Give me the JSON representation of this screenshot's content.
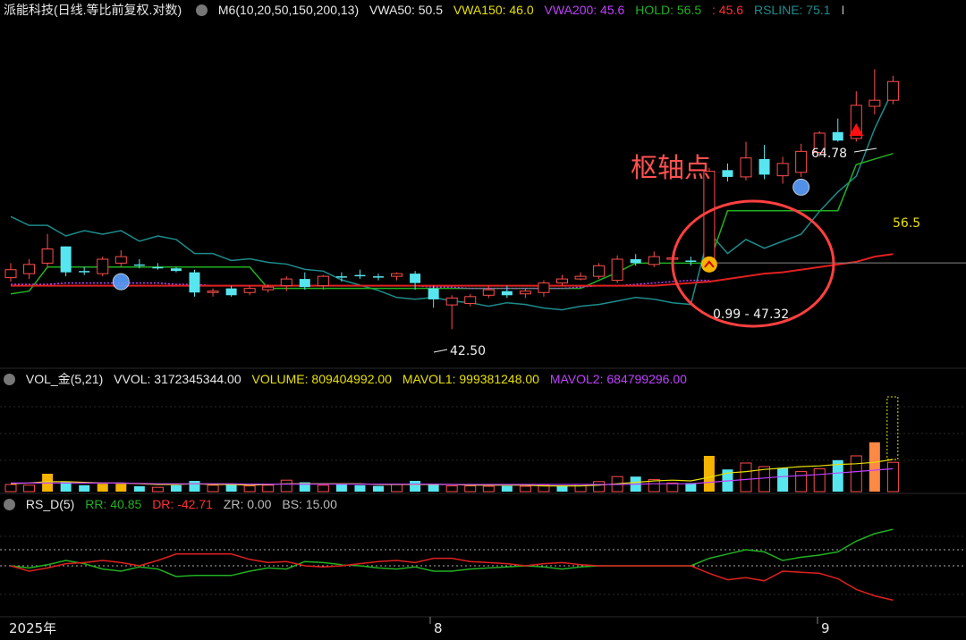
{
  "colors": {
    "bg": "#000000",
    "up": "#ff4d4d",
    "down": "#57e6f0",
    "gold": "#f5b400",
    "orange": "#ff8844",
    "teal": "#1e8c8c",
    "hold": "#22b022",
    "vwa150": "#e8e000",
    "vwa200": "#c040ff",
    "red_line": "#e02020",
    "grid": "#333333",
    "text": "#e8e8e8"
  },
  "panel_main": {
    "title": "派能科技(日线.等比前复权.对数)",
    "indicator": "M6(10,20,50,150,200,13)",
    "vwa50": "VWA50: 50.5",
    "vwa150": "VWA150: 46.0",
    "vwa200": "VWA200: 45.6",
    "hold": "HOLD: 56.5",
    "hold_extra": ": 45.6",
    "rsline": "RSLINE: 75.1",
    "rsline_extra": "I",
    "annotation": "枢轴点",
    "label_high": "64.78",
    "label_low": "42.50",
    "label_pivot": "0.99 - 47.32",
    "label_hold": "56.5"
  },
  "panel_vol": {
    "title": "VOL_金(5,21)",
    "vvol": "VVOL: 3172345344.00",
    "volume": "VOLUME: 809404992.00",
    "mavol1": "MAVOL1: 999381248.00",
    "mavol2": "MAVOL2: 684799296.00"
  },
  "panel_rs": {
    "title": "RS_D(5)",
    "rr": "RR: 40.85",
    "dr": "DR: -42.71",
    "zr": "ZR: 0.00",
    "bs": "BS: 15.00"
  },
  "x_axis": {
    "labels": [
      "2025年",
      "8",
      "9"
    ]
  },
  "chart_data": {
    "type": "candlestick",
    "price_range": [
      40,
      70
    ],
    "candles": [
      {
        "o": 46.2,
        "h": 47.3,
        "l": 45.9,
        "c": 46.8,
        "d": "up"
      },
      {
        "o": 46.5,
        "h": 47.6,
        "l": 46.1,
        "c": 47.2,
        "d": "up"
      },
      {
        "o": 47.3,
        "h": 49.6,
        "l": 47.0,
        "c": 48.4,
        "d": "up"
      },
      {
        "o": 48.6,
        "h": 48.6,
        "l": 46.3,
        "c": 46.6,
        "d": "down"
      },
      {
        "o": 46.7,
        "h": 47.0,
        "l": 46.4,
        "c": 46.6,
        "d": "down"
      },
      {
        "o": 46.5,
        "h": 47.8,
        "l": 46.3,
        "c": 47.6,
        "d": "up"
      },
      {
        "o": 47.3,
        "h": 48.3,
        "l": 47.0,
        "c": 47.8,
        "d": "up"
      },
      {
        "o": 47.2,
        "h": 47.6,
        "l": 46.9,
        "c": 47.1,
        "d": "down"
      },
      {
        "o": 47.0,
        "h": 47.3,
        "l": 46.8,
        "c": 47.0,
        "d": "down"
      },
      {
        "o": 46.9,
        "h": 47.0,
        "l": 46.6,
        "c": 46.7,
        "d": "down"
      },
      {
        "o": 46.6,
        "h": 46.8,
        "l": 44.8,
        "c": 45.1,
        "d": "down"
      },
      {
        "o": 45.1,
        "h": 45.4,
        "l": 44.8,
        "c": 45.2,
        "d": "up"
      },
      {
        "o": 45.4,
        "h": 45.6,
        "l": 44.8,
        "c": 44.9,
        "d": "down"
      },
      {
        "o": 45.1,
        "h": 45.6,
        "l": 44.9,
        "c": 45.4,
        "d": "up"
      },
      {
        "o": 45.3,
        "h": 45.7,
        "l": 45.1,
        "c": 45.5,
        "d": "up"
      },
      {
        "o": 45.6,
        "h": 46.3,
        "l": 45.2,
        "c": 46.1,
        "d": "up"
      },
      {
        "o": 46.1,
        "h": 46.6,
        "l": 45.3,
        "c": 45.5,
        "d": "down"
      },
      {
        "o": 45.6,
        "h": 46.4,
        "l": 45.3,
        "c": 46.3,
        "d": "up"
      },
      {
        "o": 46.2,
        "h": 46.6,
        "l": 45.9,
        "c": 46.3,
        "d": "down"
      },
      {
        "o": 46.4,
        "h": 46.8,
        "l": 46.1,
        "c": 46.3,
        "d": "down"
      },
      {
        "o": 46.2,
        "h": 46.5,
        "l": 46.0,
        "c": 46.3,
        "d": "down"
      },
      {
        "o": 46.3,
        "h": 46.6,
        "l": 46.0,
        "c": 46.5,
        "d": "up"
      },
      {
        "o": 46.5,
        "h": 46.7,
        "l": 45.3,
        "c": 45.8,
        "d": "down"
      },
      {
        "o": 45.4,
        "h": 45.6,
        "l": 44.0,
        "c": 44.6,
        "d": "down"
      },
      {
        "o": 44.7,
        "h": 44.9,
        "l": 42.5,
        "c": 44.2,
        "d": "up"
      },
      {
        "o": 44.3,
        "h": 45.0,
        "l": 44.1,
        "c": 44.8,
        "d": "up"
      },
      {
        "o": 44.9,
        "h": 45.6,
        "l": 44.7,
        "c": 45.3,
        "d": "up"
      },
      {
        "o": 45.2,
        "h": 45.6,
        "l": 44.7,
        "c": 44.9,
        "d": "down"
      },
      {
        "o": 45.0,
        "h": 45.4,
        "l": 44.7,
        "c": 45.2,
        "d": "up"
      },
      {
        "o": 45.1,
        "h": 46.0,
        "l": 44.8,
        "c": 45.8,
        "d": "up"
      },
      {
        "o": 45.8,
        "h": 46.4,
        "l": 45.6,
        "c": 46.1,
        "d": "up"
      },
      {
        "o": 46.1,
        "h": 46.6,
        "l": 46.0,
        "c": 46.3,
        "d": "up"
      },
      {
        "o": 46.3,
        "h": 47.3,
        "l": 46.1,
        "c": 47.1,
        "d": "up"
      },
      {
        "o": 46.0,
        "h": 47.9,
        "l": 45.8,
        "c": 47.6,
        "d": "up"
      },
      {
        "o": 47.6,
        "h": 48.0,
        "l": 47.1,
        "c": 47.3,
        "d": "down"
      },
      {
        "o": 47.2,
        "h": 48.2,
        "l": 47.0,
        "c": 47.8,
        "d": "up"
      },
      {
        "o": 47.7,
        "h": 47.9,
        "l": 47.2,
        "c": 47.6,
        "d": "up"
      },
      {
        "o": 47.5,
        "h": 47.8,
        "l": 47.1,
        "c": 47.4,
        "d": "down"
      },
      {
        "o": 47.3,
        "h": 55.2,
        "l": 46.99,
        "c": 54.9,
        "d": "up"
      },
      {
        "o": 55.0,
        "h": 55.6,
        "l": 54.0,
        "c": 54.4,
        "d": "down"
      },
      {
        "o": 54.4,
        "h": 57.6,
        "l": 54.1,
        "c": 56.1,
        "d": "up"
      },
      {
        "o": 56.0,
        "h": 57.3,
        "l": 54.2,
        "c": 54.6,
        "d": "down"
      },
      {
        "o": 54.5,
        "h": 56.2,
        "l": 53.8,
        "c": 55.6,
        "d": "up"
      },
      {
        "o": 54.8,
        "h": 57.4,
        "l": 54.4,
        "c": 56.7,
        "d": "up"
      },
      {
        "o": 56.6,
        "h": 58.6,
        "l": 56.2,
        "c": 58.4,
        "d": "up"
      },
      {
        "o": 58.5,
        "h": 59.8,
        "l": 57.6,
        "c": 57.7,
        "d": "down"
      },
      {
        "o": 57.9,
        "h": 62.5,
        "l": 57.6,
        "c": 61.1,
        "d": "up"
      },
      {
        "o": 61.0,
        "h": 64.78,
        "l": 60.2,
        "c": 61.6,
        "d": "up"
      },
      {
        "o": 61.6,
        "h": 64.1,
        "l": 61.2,
        "c": 63.5,
        "d": "up"
      }
    ],
    "rsline": [
      62,
      61.5,
      61.5,
      60.9,
      61.2,
      61.0,
      61.2,
      60.6,
      60.9,
      60.7,
      59.9,
      59.9,
      59.5,
      59.6,
      59.4,
      59.3,
      59.0,
      58.9,
      58.4,
      58.1,
      57.8,
      57.4,
      57.3,
      57.4,
      57.2,
      57.1,
      56.9,
      57.1,
      57.0,
      56.8,
      56.7,
      56.9,
      57.0,
      57.2,
      57.4,
      57.3,
      57.1,
      57.0,
      61.1,
      59.9,
      60.7,
      60.2,
      60.6,
      61.0,
      62.3,
      63.4,
      64.3,
      67.0,
      69.2
    ],
    "hold": [
      45.0,
      45.2,
      47.0,
      47.0,
      47.0,
      47.0,
      47.0,
      47.0,
      47.0,
      47.0,
      47.0,
      47.0,
      47.0,
      47.0,
      45.4,
      45.4,
      45.4,
      45.4,
      45.4,
      45.4,
      45.4,
      45.4,
      45.4,
      45.4,
      45.4,
      45.4,
      45.4,
      45.4,
      45.4,
      45.4,
      45.4,
      45.4,
      46.0,
      46.6,
      47.3,
      47.3,
      47.3,
      47.3,
      47.3,
      51.5,
      51.5,
      51.5,
      51.5,
      51.5,
      51.5,
      51.5,
      55.5,
      56.0,
      56.5
    ],
    "vwa150_series": [
      45.7,
      45.7,
      45.7,
      45.8,
      45.8,
      45.8,
      45.8,
      45.8,
      45.8,
      45.7,
      45.7,
      45.6,
      45.6,
      45.6,
      45.6,
      45.6,
      45.6,
      45.6,
      45.6,
      45.6,
      45.6,
      45.6,
      45.6,
      45.5,
      45.5,
      45.4,
      45.4,
      45.4,
      45.4,
      45.4,
      45.4,
      45.5,
      45.6,
      45.6,
      45.7,
      45.8,
      45.9,
      46.0,
      46.0
    ],
    "vwa200_series": [
      45.6,
      45.6,
      45.6,
      45.6,
      45.6,
      45.6,
      45.6,
      45.6,
      45.6,
      45.6,
      45.6,
      45.6,
      45.6,
      45.6,
      45.6,
      45.6,
      45.6,
      45.6,
      45.6,
      45.6,
      45.6,
      45.6,
      45.6,
      45.6,
      45.6,
      45.6,
      45.6,
      45.6,
      45.6,
      45.6,
      45.6,
      45.6,
      45.6,
      45.6,
      45.6,
      45.6,
      45.7,
      45.8,
      45.9,
      46.1,
      46.3,
      46.5,
      46.6,
      46.8,
      47.0,
      47.2,
      47.4,
      47.8,
      48.0
    ],
    "volume": [
      {
        "v": 0.2,
        "c": "up"
      },
      {
        "v": 0.18,
        "c": "up"
      },
      {
        "v": 0.5,
        "c": "gold"
      },
      {
        "v": 0.28,
        "c": "down"
      },
      {
        "v": 0.18,
        "c": "down"
      },
      {
        "v": 0.22,
        "c": "gold"
      },
      {
        "v": 0.22,
        "c": "gold"
      },
      {
        "v": 0.15,
        "c": "down"
      },
      {
        "v": 0.12,
        "c": "up"
      },
      {
        "v": 0.18,
        "c": "down"
      },
      {
        "v": 0.3,
        "c": "down"
      },
      {
        "v": 0.18,
        "c": "up"
      },
      {
        "v": 0.2,
        "c": "down"
      },
      {
        "v": 0.16,
        "c": "up"
      },
      {
        "v": 0.18,
        "c": "up"
      },
      {
        "v": 0.32,
        "c": "up"
      },
      {
        "v": 0.26,
        "c": "down"
      },
      {
        "v": 0.18,
        "c": "up"
      },
      {
        "v": 0.2,
        "c": "down"
      },
      {
        "v": 0.18,
        "c": "down"
      },
      {
        "v": 0.16,
        "c": "down"
      },
      {
        "v": 0.2,
        "c": "up"
      },
      {
        "v": 0.3,
        "c": "down"
      },
      {
        "v": 0.22,
        "c": "down"
      },
      {
        "v": 0.16,
        "c": "up"
      },
      {
        "v": 0.16,
        "c": "up"
      },
      {
        "v": 0.15,
        "c": "up"
      },
      {
        "v": 0.16,
        "c": "down"
      },
      {
        "v": 0.15,
        "c": "up"
      },
      {
        "v": 0.18,
        "c": "up"
      },
      {
        "v": 0.16,
        "c": "down"
      },
      {
        "v": 0.2,
        "c": "up"
      },
      {
        "v": 0.28,
        "c": "up"
      },
      {
        "v": 0.42,
        "c": "up"
      },
      {
        "v": 0.42,
        "c": "down"
      },
      {
        "v": 0.34,
        "c": "up"
      },
      {
        "v": 0.24,
        "c": "up"
      },
      {
        "v": 0.24,
        "c": "down"
      },
      {
        "v": 1.0,
        "c": "gold"
      },
      {
        "v": 0.62,
        "c": "down"
      },
      {
        "v": 0.8,
        "c": "up"
      },
      {
        "v": 0.7,
        "c": "up"
      },
      {
        "v": 0.66,
        "c": "down"
      },
      {
        "v": 0.56,
        "c": "up"
      },
      {
        "v": 0.64,
        "c": "up"
      },
      {
        "v": 0.88,
        "c": "down"
      },
      {
        "v": 1.0,
        "c": "up"
      },
      {
        "v": 1.38,
        "c": "orange"
      },
      {
        "v": 0.82,
        "c": "up"
      }
    ],
    "mavol1": [
      0.22,
      0.24,
      0.28,
      0.28,
      0.26,
      0.24,
      0.24,
      0.22,
      0.2,
      0.2,
      0.22,
      0.2,
      0.2,
      0.18,
      0.2,
      0.22,
      0.22,
      0.22,
      0.22,
      0.22,
      0.2,
      0.2,
      0.2,
      0.2,
      0.2,
      0.18,
      0.18,
      0.18,
      0.18,
      0.16,
      0.16,
      0.16,
      0.18,
      0.22,
      0.26,
      0.3,
      0.32,
      0.3,
      0.4,
      0.52,
      0.56,
      0.62,
      0.66,
      0.7,
      0.72,
      0.76,
      0.78,
      0.82,
      0.9
    ],
    "mavol2": [
      0.24,
      0.24,
      0.24,
      0.24,
      0.24,
      0.24,
      0.24,
      0.23,
      0.22,
      0.22,
      0.22,
      0.22,
      0.22,
      0.21,
      0.21,
      0.21,
      0.21,
      0.21,
      0.21,
      0.21,
      0.21,
      0.21,
      0.21,
      0.21,
      0.2,
      0.2,
      0.2,
      0.2,
      0.2,
      0.2,
      0.2,
      0.2,
      0.2,
      0.2,
      0.21,
      0.22,
      0.22,
      0.22,
      0.26,
      0.3,
      0.34,
      0.38,
      0.42,
      0.45,
      0.48,
      0.52,
      0.56,
      0.6,
      0.64
    ],
    "rr": [
      0,
      -0.2,
      0.1,
      0.5,
      0.2,
      -0.3,
      -0.5,
      -0.1,
      -0.3,
      -1.0,
      -0.9,
      -0.9,
      -0.9,
      -0.5,
      -0.2,
      -0.3,
      0.4,
      0.3,
      0.1,
      0.0,
      -0.2,
      -0.3,
      -0.1,
      -0.5,
      -0.5,
      -0.3,
      -0.2,
      -0.1,
      0.0,
      -0.1,
      -0.3,
      -0.1,
      0.0,
      0.0,
      0.0,
      0.0,
      0.0,
      0.0,
      0.7,
      1.1,
      1.5,
      1.3,
      0.5,
      0.8,
      1.0,
      1.3,
      2.3,
      3.0,
      3.4
    ],
    "dr": [
      0,
      -0.5,
      -0.2,
      0.2,
      0.3,
      0.5,
      0.3,
      0.0,
      0.5,
      1.1,
      1.1,
      1.1,
      1.1,
      0.6,
      0.3,
      0.4,
      0.0,
      -0.1,
      0.0,
      0.2,
      0.4,
      0.5,
      0.3,
      0.7,
      0.7,
      0.4,
      0.3,
      0.2,
      0.0,
      0.2,
      0.3,
      0.1,
      0.0,
      0.0,
      0.0,
      0.0,
      0.0,
      0.0,
      -0.7,
      -1.3,
      -1.1,
      -1.4,
      -0.5,
      -0.6,
      -0.7,
      -1.2,
      -2.2,
      -2.8,
      -3.2
    ],
    "rs_range": [
      -4,
      4
    ]
  }
}
